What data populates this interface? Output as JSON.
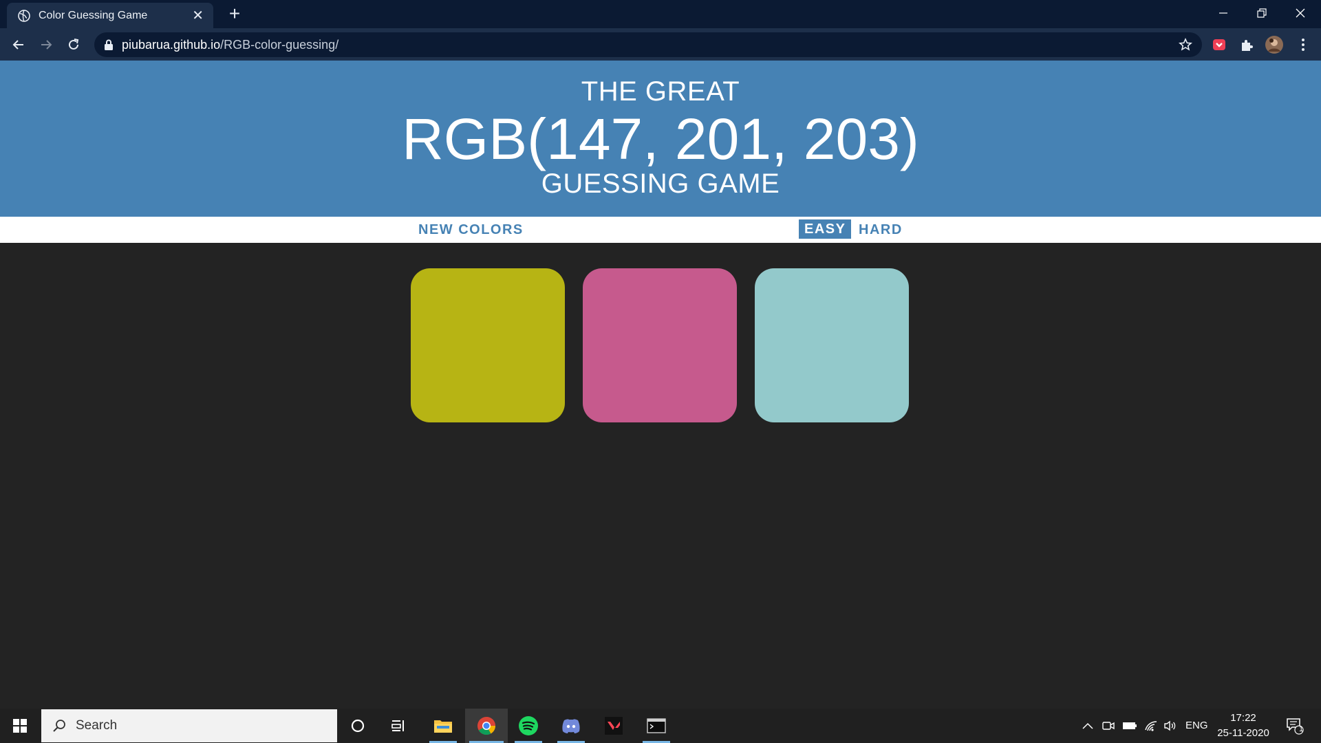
{
  "browser": {
    "tab_title": "Color Guessing Game",
    "url_host": "piubarua.github.io",
    "url_path": "/RGB-color-guessing/"
  },
  "game": {
    "heading_top": "THE GREAT",
    "rgb_display": "RGB(147, 201, 203)",
    "heading_bottom": "GUESSING GAME",
    "header_color": "#4682b4",
    "new_colors_label": "NEW COLORS",
    "message": "",
    "modes": [
      {
        "label": "EASY",
        "selected": true
      },
      {
        "label": "HARD",
        "selected": false
      }
    ],
    "squares": [
      {
        "color": "#b7b414"
      },
      {
        "color": "#c65a8d"
      },
      {
        "color": "#93c9cb"
      }
    ]
  },
  "taskbar": {
    "search_placeholder": "Search",
    "apps": [
      "file-explorer-icon",
      "chrome-icon",
      "spotify-icon",
      "discord-icon",
      "valorant-icon",
      "terminal-icon"
    ],
    "language": "ENG",
    "time": "17:22",
    "date": "25-11-2020",
    "notification_count": "1"
  }
}
